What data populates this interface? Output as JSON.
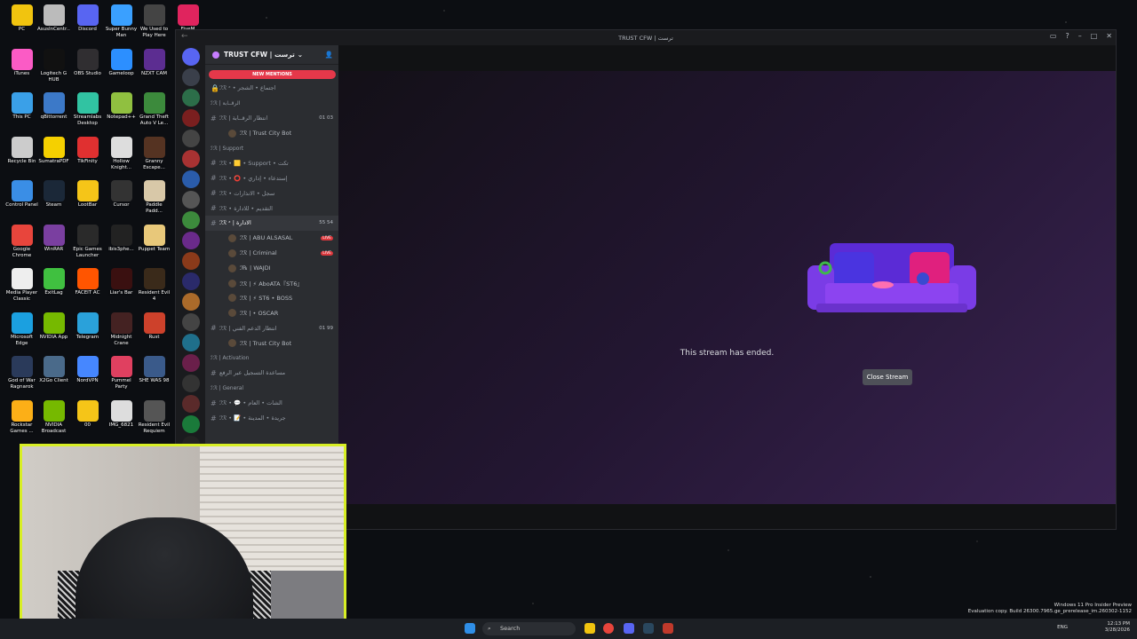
{
  "desktop": {
    "icons": [
      {
        "label": "PC",
        "color": "#f1c40f"
      },
      {
        "label": "AsusInCentr...",
        "color": "#bbbbbb"
      },
      {
        "label": "Discord",
        "color": "#5865f2"
      },
      {
        "label": "Super Bunny Man",
        "color": "#3aa0ff"
      },
      {
        "label": "We Used to Play Here",
        "color": "#444444"
      },
      {
        "label": "FiveM",
        "color": "#e0245e"
      },
      {
        "label": "iTunes",
        "color": "#fb5bc5"
      },
      {
        "label": "Logitech G HUB",
        "color": "#111111"
      },
      {
        "label": "OBS Studio",
        "color": "#302e31"
      },
      {
        "label": "Gameloop",
        "color": "#2c8fff"
      },
      {
        "label": "NZXT CAM",
        "color": "#5c2d91"
      },
      {
        "label": "This PC",
        "color": "#3aa0e8"
      },
      {
        "label": "qBittorrent",
        "color": "#3c79c8"
      },
      {
        "label": "Streamlabs Desktop",
        "color": "#31c3a2"
      },
      {
        "label": "Notepad++",
        "color": "#90c040"
      },
      {
        "label": "Grand Theft Auto V Le...",
        "color": "#3c8a3c"
      },
      {
        "label": "Recycle Bin",
        "color": "#cccccc"
      },
      {
        "label": "SumatraPDF",
        "color": "#f5d000"
      },
      {
        "label": "TikFinity",
        "color": "#e03030"
      },
      {
        "label": "Hollow Knight...",
        "color": "#dddddd"
      },
      {
        "label": "Granny Escape...",
        "color": "#553322"
      },
      {
        "label": "Control Panel",
        "color": "#3a8ee6"
      },
      {
        "label": "Steam",
        "color": "#1b2838"
      },
      {
        "label": "LootBar",
        "color": "#f5c518"
      },
      {
        "label": "Cursor",
        "color": "#333333"
      },
      {
        "label": "Paddle Padd...",
        "color": "#d8c8a8"
      },
      {
        "label": "Google Chrome",
        "color": "#e8453c"
      },
      {
        "label": "WinRAR",
        "color": "#7a3fa0"
      },
      {
        "label": "Epic Games Launcher",
        "color": "#2a2a2a"
      },
      {
        "label": "ibis3phe...",
        "color": "#222222"
      },
      {
        "label": "Puppet Team",
        "color": "#e8c87a"
      },
      {
        "label": "Media Player Classic",
        "color": "#eeeeee"
      },
      {
        "label": "ExitLag",
        "color": "#40c040"
      },
      {
        "label": "FACEIT AC",
        "color": "#ff5500"
      },
      {
        "label": "Liar's Bar",
        "color": "#3a1010"
      },
      {
        "label": "Resident Evil 4",
        "color": "#3a2a1a"
      },
      {
        "label": "Microsoft Edge",
        "color": "#1ba0e0"
      },
      {
        "label": "NVIDIA App",
        "color": "#76b900"
      },
      {
        "label": "Telegram",
        "color": "#2aa1da"
      },
      {
        "label": "Midnight Crane",
        "color": "#442222"
      },
      {
        "label": "Rust",
        "color": "#cd412b"
      },
      {
        "label": "God of War Ragnarok",
        "color": "#2a3a5a"
      },
      {
        "label": "X2Go Client",
        "color": "#4a6a8a"
      },
      {
        "label": "NordVPN",
        "color": "#4687ff"
      },
      {
        "label": "Pummel Party",
        "color": "#e04060"
      },
      {
        "label": "SHE WAS 98",
        "color": "#3a5a8a"
      },
      {
        "label": "Rockstar Games ...",
        "color": "#fcaf17"
      },
      {
        "label": "NVIDIA Broadcast",
        "color": "#76b900"
      },
      {
        "label": "00",
        "color": "#f5c518"
      },
      {
        "label": "IMG_6821",
        "color": "#dddddd"
      },
      {
        "label": "Resident Evil Requiem",
        "color": "#555555"
      }
    ]
  },
  "window": {
    "title": "TRUST CFW | ترست",
    "server_name": "TRUST CFW | ترست",
    "new_mentions": "NEW MENTIONS",
    "channels": [
      {
        "type": "channel",
        "text": "ℐℛ ᶻ • اجتماع • الشجر",
        "lock": true
      },
      {
        "type": "cat",
        "text": "ℐℛ | الرقــابة"
      },
      {
        "type": "channel",
        "text": "ℐℛ | انتظار الرقــابة",
        "count": "01 03"
      },
      {
        "type": "sub",
        "text": "ℐℛ | Trust City Bot"
      },
      {
        "type": "cat",
        "text": "ℐℛ | Support"
      },
      {
        "type": "channel",
        "text": "ℐℛ • 🟨 • Support • تكت"
      },
      {
        "type": "channel",
        "text": "ℐℛ • ⭕ • إستدعاء • إداري"
      },
      {
        "type": "channel",
        "text": "ℐℛ • سجل • الانذارات"
      },
      {
        "type": "channel",
        "text": "ℐℛ • التقديم • للادارة"
      },
      {
        "type": "channel",
        "text": "ℐℛ ᶻ | الادارة",
        "count": "55 54",
        "active": true
      },
      {
        "type": "sub",
        "text": "ℐℛ | ABU ALSASAL",
        "live": "LIVE"
      },
      {
        "type": "sub",
        "text": "ℐℛ | Criminal",
        "live": "LIVE"
      },
      {
        "type": "sub",
        "text": "ℐ℞ | WAJDI"
      },
      {
        "type": "sub",
        "text": "ℐℛ | ⚡ AboATA『ST6』"
      },
      {
        "type": "sub",
        "text": "ℐℛ | ⚡ ST6 • BOSS"
      },
      {
        "type": "sub",
        "text": "ℐℛ | • OSCAR"
      },
      {
        "type": "channel",
        "text": "ℐℛ | انتظار الدعم الفني",
        "count": "01 99"
      },
      {
        "type": "sub",
        "text": "ℐℛ | Trust City Bot"
      },
      {
        "type": "cat",
        "text": "ℐℛ | Activation"
      },
      {
        "type": "channel",
        "text": "مساعدة التسجيل عبر الرفع"
      },
      {
        "type": "cat",
        "text": "ℐℛ | General"
      },
      {
        "type": "channel",
        "text": "ℐℛ • 💬 • الشات • العام"
      },
      {
        "type": "channel",
        "text": "ℐℛ • 📝 • جريدة • المدينة"
      }
    ],
    "stream_ended": "This stream has ended.",
    "close_stream": "Close Stream"
  },
  "taskbar": {
    "search_placeholder": "Search",
    "lang": "ENG",
    "time": "12:13 PM",
    "date": "3/28/2026"
  },
  "watermark": {
    "line1": "Windows 11 Pro Insider Preview",
    "line2": "Evaluation copy. Build 26300.7965.ge_prerelease_im.260302-1152"
  }
}
